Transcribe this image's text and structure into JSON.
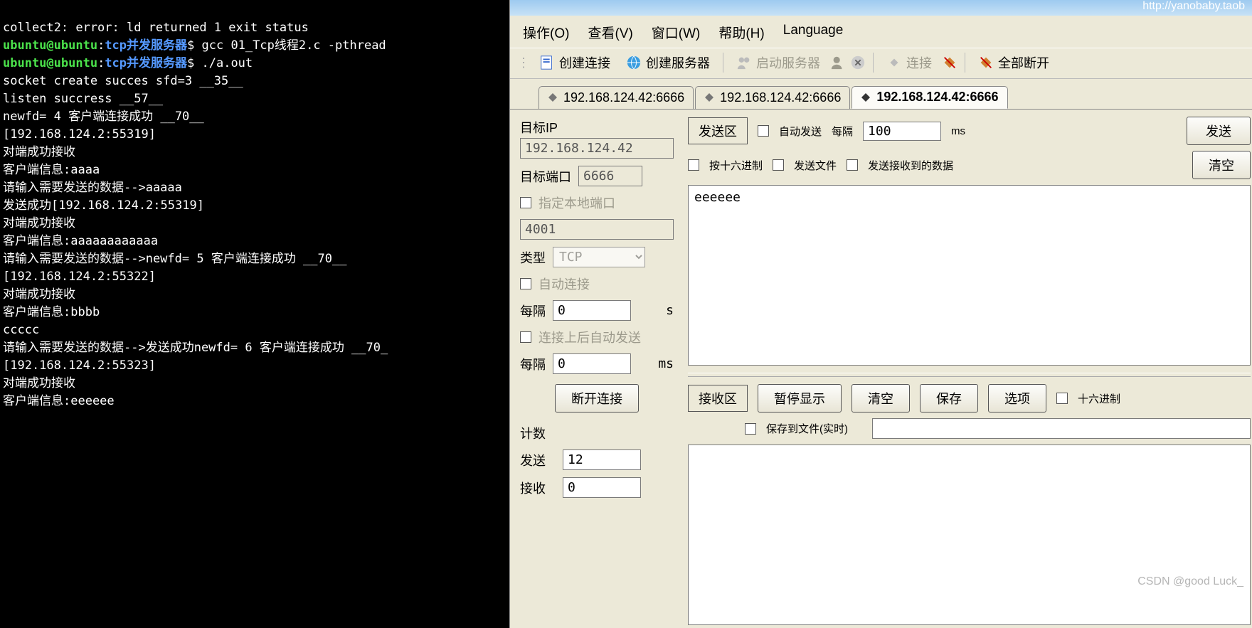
{
  "terminal": {
    "line0": "collect2: error: ld returned 1 exit status",
    "prompt1_user": "ubuntu@ubuntu",
    "prompt1_path": "tcp并发服务器",
    "prompt1_cmd": "$ gcc 01_Tcp线程2.c -pthread",
    "prompt2_user": "ubuntu@ubuntu",
    "prompt2_path": "tcp并发服务器",
    "prompt2_cmd": "$ ./a.out",
    "l1": "socket create succes sfd=3 __35__",
    "l2": "listen succress __57__",
    "l3": "newfd= 4 客户端连接成功 __70__",
    "l4": "[192.168.124.2:55319]",
    "l5": "对端成功接收",
    "l6": "客户端信息:aaaa",
    "l7": "请输入需要发送的数据-->aaaaa",
    "l8": "发送成功[192.168.124.2:55319]",
    "l9": "对端成功接收",
    "l10": "客户端信息:aaaaaaaaaaaa",
    "l11": "请输入需要发送的数据-->newfd= 5 客户端连接成功 __70__",
    "l12": "[192.168.124.2:55322]",
    "l13": "对端成功接收",
    "l14": "客户端信息:bbbb",
    "l15": "ccccc",
    "l16": "请输入需要发送的数据-->发送成功newfd= 6 客户端连接成功 __70_",
    "l17": "[192.168.124.2:55323]",
    "l18": "对端成功接收",
    "l19": "客户端信息:eeeeee"
  },
  "banner": {
    "url": "http://yanobaby.taob"
  },
  "menu": {
    "operate": "操作(O)",
    "view": "查看(V)",
    "window": "窗口(W)",
    "help": "帮助(H)",
    "lang": "Language"
  },
  "toolbar": {
    "createConn": "创建连接",
    "createServer": "创建服务器",
    "startServer": "启动服务器",
    "connect": "连接",
    "disconnectAll": "全部断开"
  },
  "tabs": {
    "t0": "192.168.124.42:6666",
    "t1": "192.168.124.42:6666",
    "t2": "192.168.124.42:6666"
  },
  "left": {
    "targetIpLabel": "目标IP",
    "targetIp": "192.168.124.42",
    "targetPortLabel": "目标端口",
    "targetPort": "6666",
    "localPortChk": "指定本地端口",
    "localPort": "4001",
    "typeLabel": "类型",
    "typeValue": "TCP",
    "autoConn": "自动连接",
    "interval1Label": "每隔",
    "interval1": "0",
    "interval1Unit": "s",
    "autoSendOnConn": "连接上后自动发送",
    "interval2Label": "每隔",
    "interval2": "0",
    "interval2Unit": "ms",
    "disconnectBtn": "断开连接",
    "countLabel": "计数",
    "sendLabel": "发送",
    "sendCount": "12",
    "recvLabel": "接收",
    "recvCount": "0"
  },
  "send": {
    "area": "发送区",
    "autoSend": "自动发送",
    "intervalLabel": "每隔",
    "interval": "100",
    "intervalUnit": "ms",
    "sendBtn": "发送",
    "hexChk": "按十六进制",
    "fileChk": "发送文件",
    "recvDataChk": "发送接收到的数据",
    "clearBtn": "清空",
    "content": "eeeeee"
  },
  "recv": {
    "area": "接收区",
    "pauseBtn": "暂停显示",
    "clearBtn": "清空",
    "saveBtn": "保存",
    "optionBtn": "选项",
    "hexChk": "十六进制",
    "saveFileChk": "保存到文件(实时)",
    "content": ""
  },
  "watermark": "CSDN @good Luck_"
}
